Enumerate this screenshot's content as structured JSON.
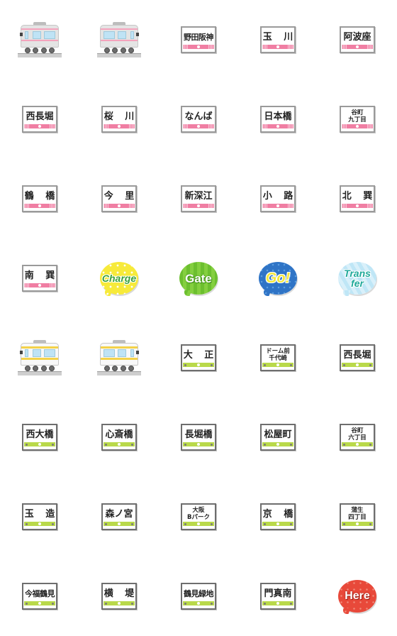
{
  "sticker_set": {
    "theme": "Osaka Metro Nagahori Tsurumi-ryokuchi line / Sennichimae line station signs",
    "colors": {
      "pink_line": "#f07ea3",
      "green_line": "#b9d94a",
      "sign_border_pink": "#9a9a9a",
      "sign_border_green": "#6e6e6e"
    },
    "stickers": [
      {
        "type": "train",
        "color": "pink",
        "facing": "left",
        "icon": "pink-train-icon"
      },
      {
        "type": "train",
        "color": "pink",
        "facing": "right",
        "icon": "pink-train-icon"
      },
      {
        "type": "sign",
        "line": "pink",
        "label": "野田阪神"
      },
      {
        "type": "sign",
        "line": "pink",
        "label": "玉 川"
      },
      {
        "type": "sign",
        "line": "pink",
        "label": "阿波座"
      },
      {
        "type": "sign",
        "line": "pink",
        "label": "西長堀"
      },
      {
        "type": "sign",
        "line": "pink",
        "label": "桜 川"
      },
      {
        "type": "sign",
        "line": "pink",
        "label": "なんば"
      },
      {
        "type": "sign",
        "line": "pink",
        "label": "日本橋"
      },
      {
        "type": "sign",
        "line": "pink",
        "label": "谷町\n九丁目",
        "two_line": true
      },
      {
        "type": "sign",
        "line": "pink",
        "label": "鶴 橋"
      },
      {
        "type": "sign",
        "line": "pink",
        "label": "今 里"
      },
      {
        "type": "sign",
        "line": "pink",
        "label": "新深江"
      },
      {
        "type": "sign",
        "line": "pink",
        "label": "小 路"
      },
      {
        "type": "sign",
        "line": "pink",
        "label": "北 巽"
      },
      {
        "type": "sign",
        "line": "pink",
        "label": "南 巽"
      },
      {
        "type": "bubble",
        "style": "charge",
        "label": "Charge"
      },
      {
        "type": "bubble",
        "style": "gate",
        "label": "Gate"
      },
      {
        "type": "bubble",
        "style": "go",
        "label": "Go!"
      },
      {
        "type": "bubble",
        "style": "transfer",
        "label": "Trans\nfer"
      },
      {
        "type": "train",
        "color": "yellow",
        "facing": "left",
        "icon": "green-line-train-icon"
      },
      {
        "type": "train",
        "color": "yellow",
        "facing": "right",
        "icon": "green-line-train-icon"
      },
      {
        "type": "sign",
        "line": "green",
        "label": "大 正"
      },
      {
        "type": "sign",
        "line": "green",
        "label": "ドーム前\n千代崎",
        "two_line": true
      },
      {
        "type": "sign",
        "line": "green",
        "label": "西長堀"
      },
      {
        "type": "sign",
        "line": "green",
        "label": "西大橋"
      },
      {
        "type": "sign",
        "line": "green",
        "label": "心斎橋"
      },
      {
        "type": "sign",
        "line": "green",
        "label": "長堀橋"
      },
      {
        "type": "sign",
        "line": "green",
        "label": "松屋町"
      },
      {
        "type": "sign",
        "line": "green",
        "label": "谷町\n六丁目",
        "two_line": true
      },
      {
        "type": "sign",
        "line": "green",
        "label": "玉 造"
      },
      {
        "type": "sign",
        "line": "green",
        "label": "森ノ宮"
      },
      {
        "type": "sign",
        "line": "green",
        "label": "大阪\nBパーク",
        "two_line": true
      },
      {
        "type": "sign",
        "line": "green",
        "label": "京 橋"
      },
      {
        "type": "sign",
        "line": "green",
        "label": "蒲生\n四丁目",
        "two_line": true
      },
      {
        "type": "sign",
        "line": "green",
        "label": "今福鶴見"
      },
      {
        "type": "sign",
        "line": "green",
        "label": "横 堤"
      },
      {
        "type": "sign",
        "line": "green",
        "label": "鶴見緑地"
      },
      {
        "type": "sign",
        "line": "green",
        "label": "門真南"
      },
      {
        "type": "bubble",
        "style": "here",
        "label": "Here"
      }
    ]
  }
}
